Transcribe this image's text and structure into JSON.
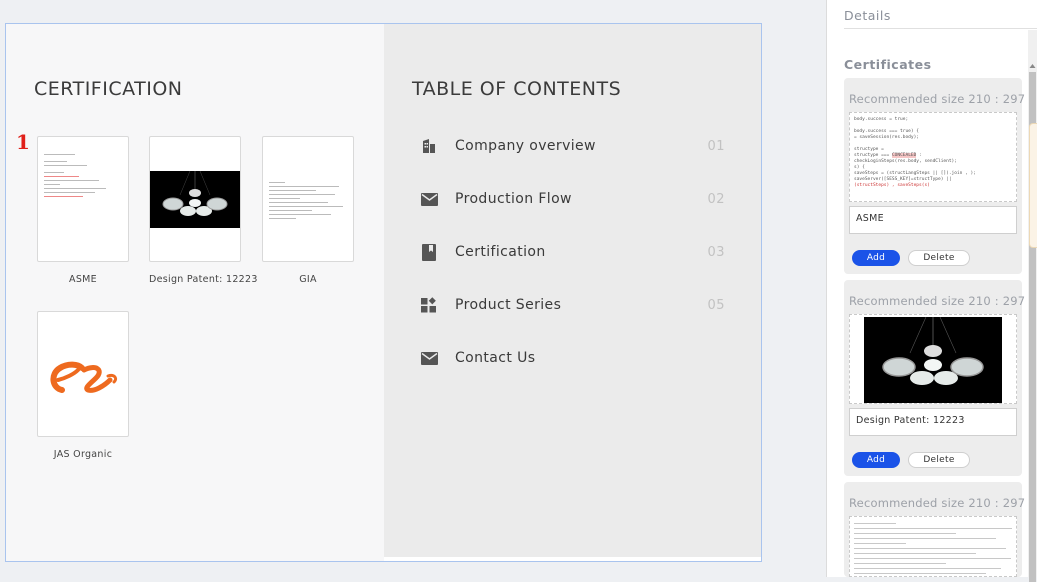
{
  "left_page": {
    "title": "CERTIFICATION",
    "page_number": "1",
    "certificates": [
      {
        "name": "ASME",
        "thumb": "code-document"
      },
      {
        "name": "Design Patent: 12223",
        "thumb": "chandelier-photo"
      },
      {
        "name": "GIA",
        "thumb": "text-document"
      },
      {
        "name": "JAS Organic",
        "thumb": "alibaba-logo"
      }
    ]
  },
  "right_page": {
    "title": "TABLE OF CONTENTS",
    "toc": [
      {
        "label": "Company overview",
        "num": "01",
        "icon": "building-icon"
      },
      {
        "label": "Production Flow",
        "num": "02",
        "icon": "mail-icon"
      },
      {
        "label": "Certification",
        "num": "03",
        "icon": "bookmark-icon"
      },
      {
        "label": "Product Series",
        "num": "05",
        "icon": "widgets-icon"
      },
      {
        "label": "Contact Us",
        "num": "",
        "icon": "mail-icon"
      }
    ]
  },
  "panel": {
    "details_label": "Details",
    "certificates_label": "Certificates",
    "recommended_size": "Recommended size 210 : 297",
    "add_label": "Add",
    "delete_label": "Delete",
    "items": [
      {
        "name": "ASME"
      },
      {
        "name": "Design Patent: 12223"
      },
      {
        "name": ""
      }
    ]
  },
  "colors": {
    "accent": "#1b53e8",
    "page_number": "#e0201a",
    "canvas_border": "#a9c4ee"
  }
}
